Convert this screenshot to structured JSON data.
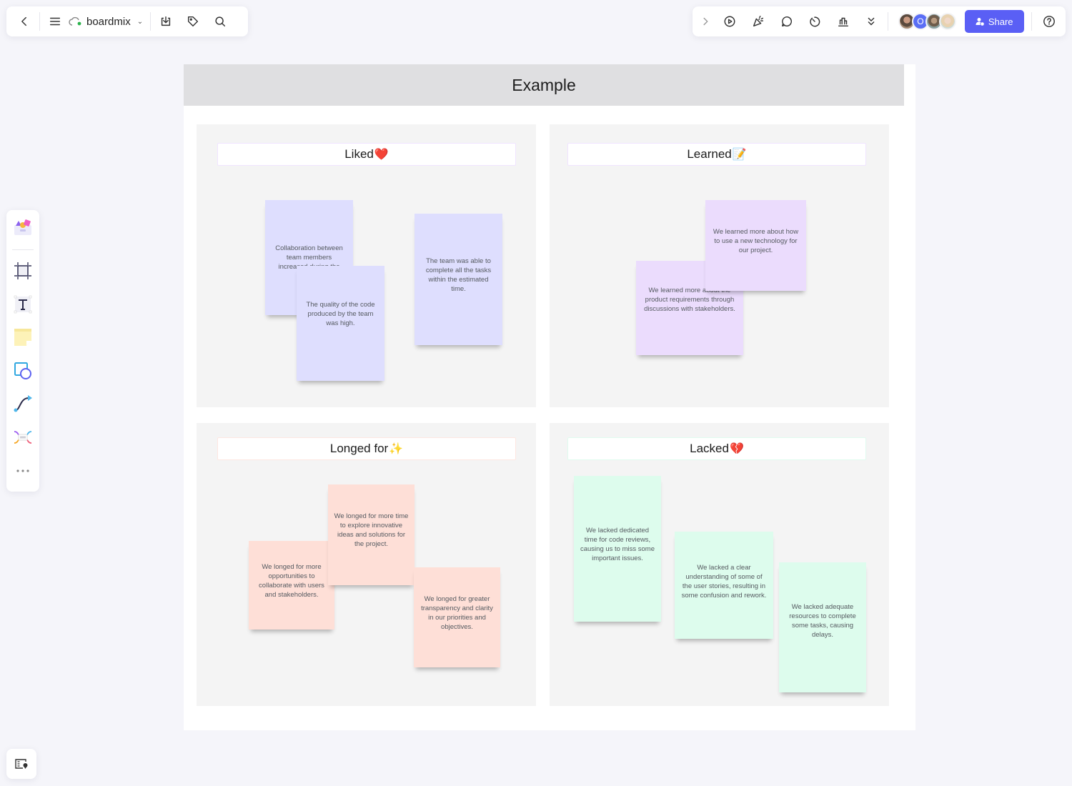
{
  "toolbar_left": {
    "back_icon": "chevron-left-icon",
    "menu_icon": "hamburger-menu-icon",
    "cloud_icon": "cloud-synced-icon",
    "file_name": "boardmix",
    "dropdown_icon": "chevron-down-icon",
    "import_icon": "download-tray-icon",
    "tag_icon": "tag-icon",
    "search_icon": "search-icon"
  },
  "toolbar_right": {
    "expand_icon": "chevron-right-icon",
    "tools": [
      "play-presentation-icon",
      "celebrate-icon",
      "comment-icon",
      "timer-icon",
      "vote-chart-icon",
      "more-double-chevron-icon"
    ],
    "collaborators": [
      {
        "name": "user-1",
        "initial": ""
      },
      {
        "name": "user-2",
        "initial": "O"
      },
      {
        "name": "user-3",
        "initial": ""
      },
      {
        "name": "user-4",
        "initial": ""
      }
    ],
    "share_label": "Share",
    "share_color": "#5a5ff5",
    "help_icon": "help-circle-icon"
  },
  "left_toolbar": {
    "tools": [
      "templates",
      "frame",
      "text",
      "sticky-note",
      "shapes",
      "connector",
      "mind-map",
      "more"
    ]
  },
  "board": {
    "title": "Example",
    "quadrants": [
      {
        "id": "liked",
        "label": "Liked",
        "emoji": "❤️",
        "color": "#dedefe",
        "notes": [
          "Collaboration between team members increased during the sprint.",
          "The quality of the code produced by the team was high.",
          "The team was able to complete all the tasks within the estimated time."
        ]
      },
      {
        "id": "learned",
        "label": "Learned",
        "emoji": "📝",
        "color": "#ebdcfd",
        "notes": [
          "We learned more about the product requirements through discussions with stakeholders.",
          "We learned more about how to use a new technology for our project."
        ]
      },
      {
        "id": "longed-for",
        "label": "Longed for",
        "emoji": "✨",
        "color": "#fedfd7",
        "notes": [
          "We longed for more opportunities to collaborate with users and stakeholders.",
          "We longed for more time to explore innovative ideas and solutions for the project.",
          "We longed for greater transparency and clarity in our priorities and objectives."
        ]
      },
      {
        "id": "lacked",
        "label": "Lacked",
        "emoji": "💔",
        "color": "#ddfced",
        "notes": [
          "We lacked dedicated time for code reviews, causing us to miss some important issues.",
          "We lacked a clear understanding of some of the user stories, resulting in some confusion and rework.",
          "We lacked adequate resources to complete some tasks, causing delays."
        ]
      }
    ]
  },
  "minimap_icon": "minimap-icon"
}
